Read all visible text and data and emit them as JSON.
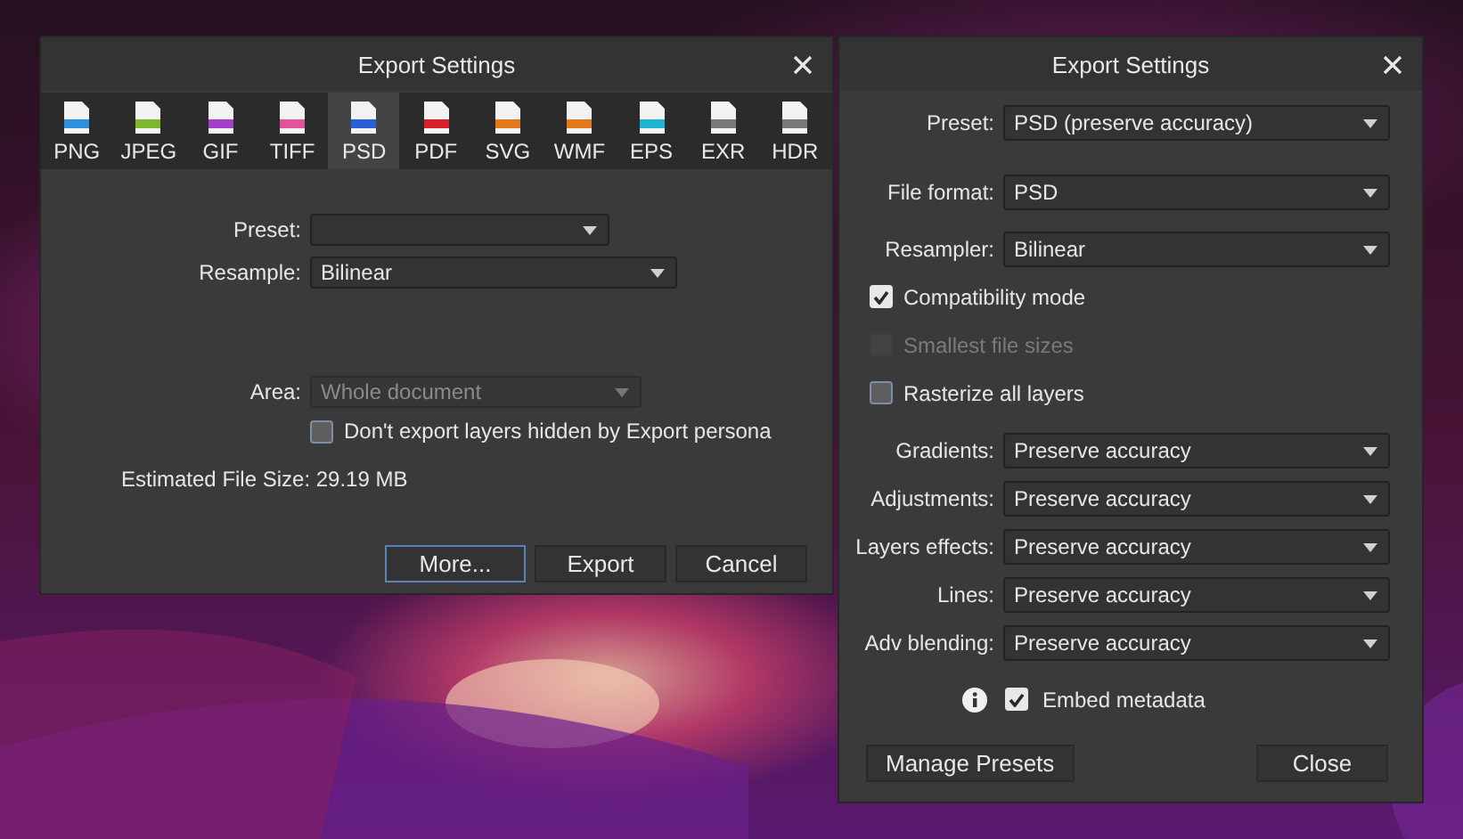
{
  "export_dialog": {
    "title": "Export Settings",
    "formats": [
      {
        "label": "PNG",
        "color": "#2f8fe0",
        "selected": false
      },
      {
        "label": "JPEG",
        "color": "#7cb82f",
        "selected": false
      },
      {
        "label": "GIF",
        "color": "#a23ec8",
        "selected": false
      },
      {
        "label": "TIFF",
        "color": "#e0559a",
        "selected": false
      },
      {
        "label": "PSD",
        "color": "#2a5fd8",
        "selected": true
      },
      {
        "label": "PDF",
        "color": "#d8202a",
        "selected": false
      },
      {
        "label": "SVG",
        "color": "#e07a1c",
        "selected": false
      },
      {
        "label": "WMF",
        "color": "#e07a1c",
        "selected": false
      },
      {
        "label": "EPS",
        "color": "#1fb5d0",
        "selected": false
      },
      {
        "label": "EXR",
        "color": "#7a7a7a",
        "selected": false
      },
      {
        "label": "HDR",
        "color": "#7a7a7a",
        "selected": false
      }
    ],
    "preset": {
      "label": "Preset:"
    },
    "resample": {
      "label": "Resample:",
      "value": "Bilinear"
    },
    "area": {
      "label": "Area:",
      "value": "Whole document",
      "disabled": true
    },
    "hidden_layers": {
      "label": "Don't export layers hidden by Export persona",
      "checked": false
    },
    "estimated_size": "Estimated File Size: 29.19 MB",
    "buttons": [
      {
        "label": "More...",
        "focused": true
      },
      {
        "label": "Export",
        "focused": false
      },
      {
        "label": "Cancel",
        "focused": false
      }
    ]
  },
  "preset_dialog": {
    "title": "Export Settings",
    "sections": [
      {
        "rows": [
          {
            "kind": "dropdown",
            "label": "Preset:",
            "value": "PSD (preserve accuracy)"
          }
        ]
      },
      {
        "rows": [
          {
            "kind": "dropdown",
            "label": "File format:",
            "value": "PSD"
          }
        ]
      },
      {
        "rows": [
          {
            "kind": "dropdown",
            "label": "Resampler:",
            "value": "Bilinear"
          },
          {
            "kind": "checkbox",
            "label": "Compatibility mode",
            "checked": true,
            "disabled": false
          },
          {
            "kind": "checkbox",
            "label": "Smallest file sizes",
            "checked": false,
            "disabled": true
          },
          {
            "kind": "checkbox",
            "label": "Rasterize all layers",
            "checked": false,
            "disabled": false
          }
        ]
      },
      {
        "rows": [
          {
            "kind": "dropdown",
            "label": "Gradients:",
            "value": "Preserve accuracy"
          },
          {
            "kind": "dropdown",
            "label": "Adjustments:",
            "value": "Preserve accuracy"
          },
          {
            "kind": "dropdown",
            "label": "Layers effects:",
            "value": "Preserve accuracy"
          },
          {
            "kind": "dropdown",
            "label": "Lines:",
            "value": "Preserve accuracy"
          },
          {
            "kind": "dropdown",
            "label": "Adv blending:",
            "value": "Preserve accuracy"
          }
        ]
      },
      {
        "rows": [
          {
            "kind": "info_checkbox",
            "label": "Embed metadata",
            "checked": true,
            "disabled": false
          }
        ]
      }
    ],
    "buttons": [
      {
        "label": "Manage Presets"
      },
      {
        "label": "Close"
      }
    ]
  }
}
